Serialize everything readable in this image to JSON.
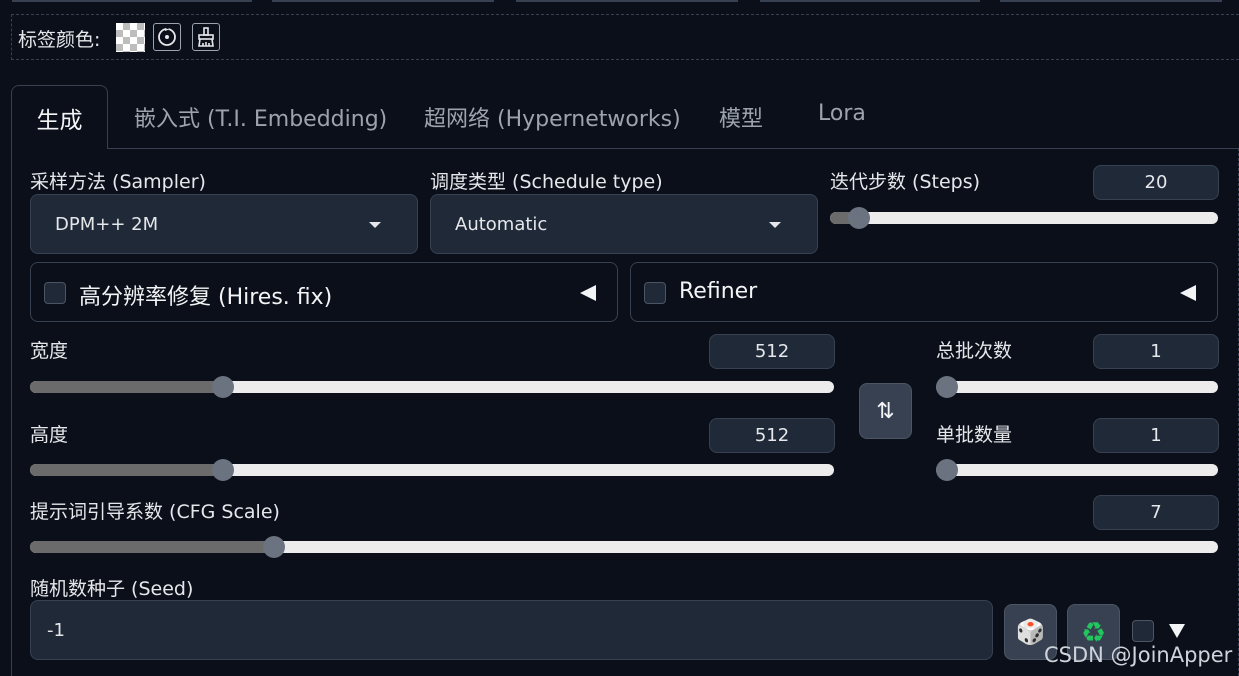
{
  "label_color": {
    "label": "标签颜色:",
    "buttons": [
      "transparent-swatch-icon",
      "reset-icon",
      "paint-brush-icon"
    ]
  },
  "tabs": [
    {
      "label": "生成",
      "active": true
    },
    {
      "label": "嵌入式 (T.I. Embedding)",
      "active": false
    },
    {
      "label": "超网络 (Hypernetworks)",
      "active": false
    },
    {
      "label": "模型",
      "active": false
    },
    {
      "label": "Lora",
      "active": false
    }
  ],
  "sampler": {
    "label": "采样方法 (Sampler)",
    "value": "DPM++ 2M"
  },
  "schedule": {
    "label": "调度类型 (Schedule type)",
    "value": "Automatic"
  },
  "steps": {
    "label": "迭代步数 (Steps)",
    "value": "20",
    "fraction": 0.05
  },
  "hires": {
    "label": "高分辨率修复 (Hires. fix)",
    "checked": false
  },
  "refiner": {
    "label": "Refiner",
    "checked": false
  },
  "width": {
    "label": "宽度",
    "value": "512",
    "fraction": 0.233
  },
  "height": {
    "label": "高度",
    "value": "512",
    "fraction": 0.233
  },
  "batch_count": {
    "label": "总批次数",
    "value": "1",
    "fraction": 0.0
  },
  "batch_size": {
    "label": "单批数量",
    "value": "1",
    "fraction": 0.0
  },
  "swap_button": {
    "icon": "swap-arrows-icon",
    "glyph": "⇅"
  },
  "cfg": {
    "label": "提示词引导系数 (CFG Scale)",
    "value": "7",
    "fraction": 0.2
  },
  "seed": {
    "label": "随机数种子 (Seed)",
    "value": "-1",
    "random_icon": "dice-icon",
    "random_glyph": "🎲",
    "reuse_icon": "recycle-icon",
    "reuse_glyph": "♻",
    "extra_checked": false
  },
  "watermark": "CSDN @JoinApper",
  "colors": {
    "background": "#0b0f19",
    "input": "#1f2937",
    "border": "#374151",
    "slider_fill": "#6b6b6b",
    "recycle": "#22c55e"
  }
}
